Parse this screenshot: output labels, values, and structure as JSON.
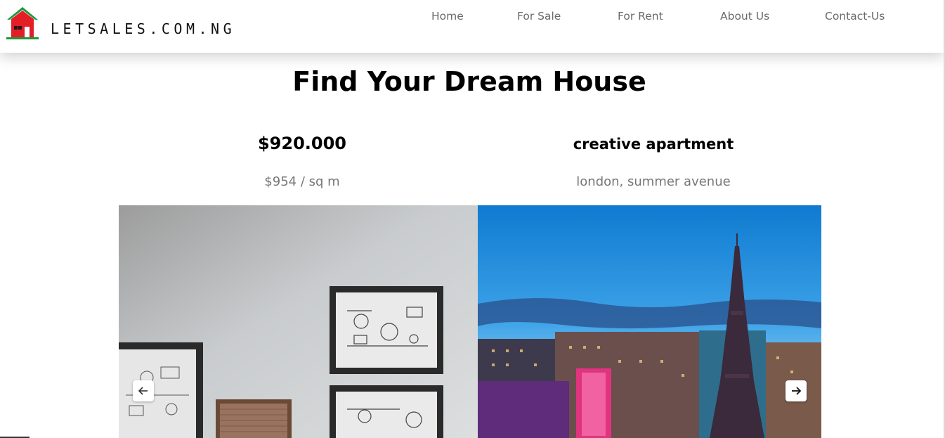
{
  "brand": {
    "name": "LETSALES.COM.NG",
    "logo_icon": "house-logo-icon"
  },
  "nav": {
    "items": [
      {
        "label": "Home"
      },
      {
        "label": "For Sale"
      },
      {
        "label": "For Rent"
      },
      {
        "label": "About Us"
      },
      {
        "label": "Contact-Us"
      }
    ]
  },
  "hero": {
    "title": "Find Your Dream House"
  },
  "listing": {
    "price": "$920.000",
    "price_per_area": "$954 / sq m",
    "title": "creative apartment",
    "address": "london, summer avenue"
  },
  "slider": {
    "prev_icon": "arrow-left-icon",
    "next_icon": "arrow-right-icon"
  },
  "colors": {
    "logo_roof": "#1a9a3a",
    "logo_house": "#e41e26",
    "nav_text": "#6a6a6a",
    "sky": "#1d86d6"
  }
}
